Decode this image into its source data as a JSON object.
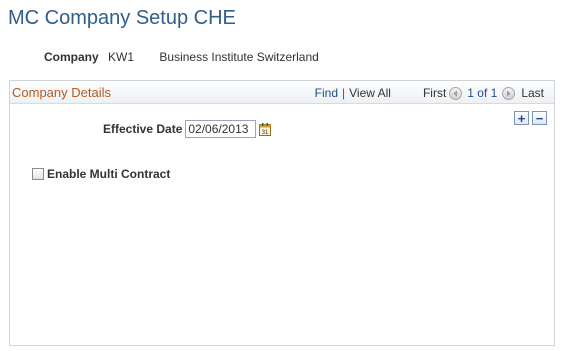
{
  "page": {
    "title": "MC Company Setup CHE"
  },
  "company": {
    "label": "Company",
    "code": "KW1",
    "description": "Business Institute Switzerland"
  },
  "panel": {
    "title": "Company Details",
    "nav": {
      "find": "Find",
      "separator": "|",
      "view_all": "View All",
      "first": "First",
      "range": "1 of 1",
      "last": "Last"
    },
    "add_label": "+",
    "delete_label": "−",
    "effective_date": {
      "label": "Effective Date",
      "value": "02/06/2013"
    },
    "enable_multi_contract": {
      "label": "Enable Multi Contract",
      "checked": false
    }
  },
  "colors": {
    "title": "#2f5e8c",
    "panel_title": "#b35b1f",
    "link": "#1f4e8c"
  },
  "icons": [
    "calendar-icon",
    "previous-arrow-icon",
    "next-arrow-icon",
    "add-row-icon",
    "delete-row-icon"
  ]
}
